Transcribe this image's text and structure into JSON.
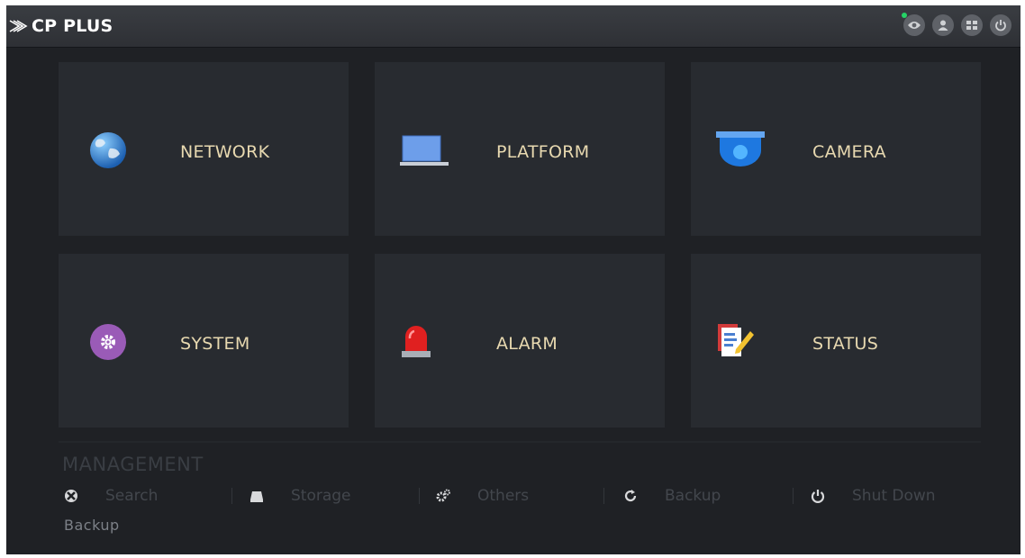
{
  "header": {
    "logo_text": "CP PLUS",
    "icons": [
      "eye-icon",
      "user-icon",
      "menu-icon",
      "power-icon"
    ]
  },
  "tiles": [
    {
      "label": "NETWORK",
      "icon": "globe-icon"
    },
    {
      "label": "PLATFORM",
      "icon": "laptop-icon"
    },
    {
      "label": "CAMERA",
      "icon": "dome-camera-icon"
    },
    {
      "label": "SYSTEM",
      "icon": "gear-icon"
    },
    {
      "label": "ALARM",
      "icon": "siren-icon"
    },
    {
      "label": "STATUS",
      "icon": "document-edit-icon"
    }
  ],
  "management": {
    "title": "MANAGEMENT",
    "items": [
      {
        "label": "Search",
        "icon": "search-icon"
      },
      {
        "label": "Storage",
        "icon": "storage-icon"
      },
      {
        "label": "Others",
        "icon": "gears-icon"
      },
      {
        "label": "Backup",
        "icon": "refresh-icon"
      },
      {
        "label": "Shut Down",
        "icon": "power-icon"
      }
    ],
    "tooltip": "Backup"
  },
  "colors": {
    "background": "#1f2125",
    "tile": "#282b30",
    "tile_label": "#e8d9b0",
    "topbar": "#34373c"
  }
}
